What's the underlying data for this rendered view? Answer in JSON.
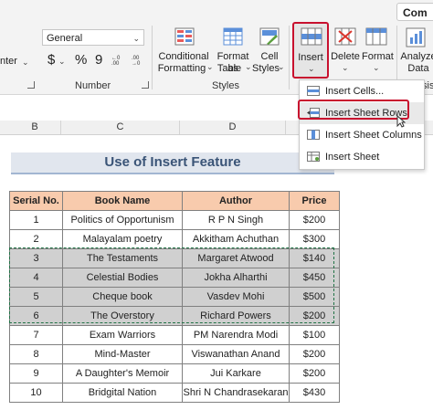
{
  "top_button": {
    "label": "Com"
  },
  "ribbon": {
    "number_format": "General",
    "partial_left_text": "nter",
    "currency_symbol": "$",
    "percent_symbol": "%",
    "comma_symbol": "9",
    "group_number_label": "Number",
    "group_styles_label": "Styles",
    "group_analysis_label": "sis",
    "conditional_formatting": {
      "line1": "Conditional",
      "line2": "Formatting"
    },
    "format_as_table": {
      "line1": "Format as",
      "line2": "Table"
    },
    "cell_styles": {
      "line1": "Cell",
      "line2": "Styles"
    },
    "insert": "Insert",
    "delete": "Delete",
    "format": "Format",
    "analyze": {
      "line1": "Analyze",
      "line2": "Data"
    }
  },
  "menu": {
    "items": [
      "Insert Cells...",
      "Insert Sheet Rows",
      "Insert Sheet Columns",
      "Insert Sheet"
    ]
  },
  "grid": {
    "columns": [
      "B",
      "C",
      "D",
      "E"
    ],
    "title": "Use of Insert Feature",
    "headers": [
      "Serial No.",
      "Book Name",
      "Author",
      "Price"
    ],
    "rows": [
      [
        "1",
        "Politics of Opportunism",
        "R P N Singh",
        "$200"
      ],
      [
        "2",
        "Malayalam poetry",
        "Akkitham Achuthan",
        "$300"
      ],
      [
        "3",
        "The Testaments",
        "Margaret Atwood",
        "$140"
      ],
      [
        "4",
        "Celestial Bodies",
        "Jokha Alharthi",
        "$450"
      ],
      [
        "5",
        "Cheque book",
        "Vasdev Mohi",
        "$500"
      ],
      [
        "6",
        "The Overstory",
        "Richard Powers",
        "$200"
      ],
      [
        "7",
        "Exam Warriors",
        "PM Narendra Modi",
        "$100"
      ],
      [
        "8",
        "Mind-Master",
        "Viswanathan Anand",
        "$200"
      ],
      [
        "9",
        "A Daughter's Memoir",
        "Jui Karkare",
        "$200"
      ],
      [
        "10",
        "Bridgital Nation",
        "Shri N Chandrasekaran",
        "$430"
      ]
    ]
  },
  "colors": {
    "header_fill": "#f8cbad",
    "selected_fill": "#d0d0d0",
    "highlight": "#c8102e",
    "title_fill": "#e1e6ee"
  }
}
